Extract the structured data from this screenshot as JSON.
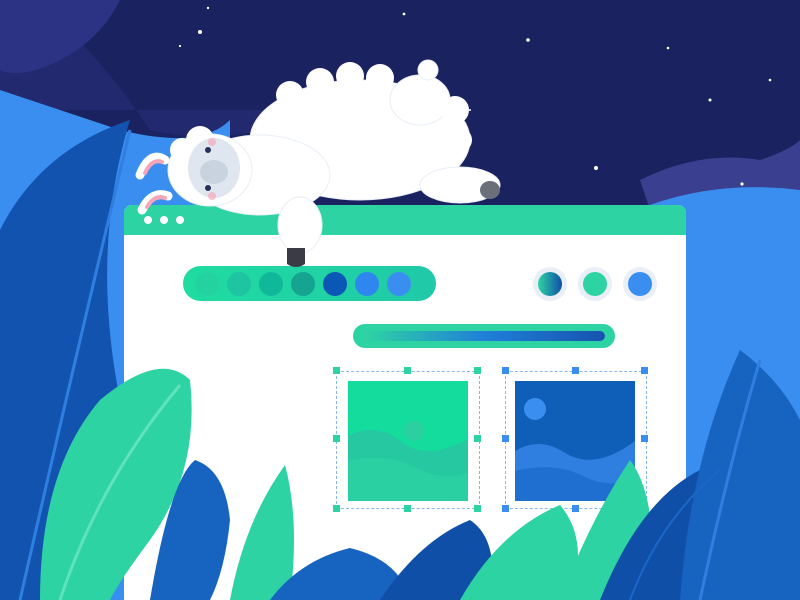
{
  "colors": {
    "sky": "#1a2260",
    "sky_band": "#3b3f8f",
    "blue_wave": "#3a8ef0",
    "window_bar": "#2ed3a3",
    "window_body": "#ffffff",
    "teal_leaf": "#2ed3a3",
    "blue_leaf": "#1763c0",
    "deep_leaf": "#0f4fa8"
  },
  "window": {
    "controls": [
      "dot",
      "dot",
      "dot"
    ]
  },
  "palette": {
    "swatches": [
      "#22d3a0",
      "#1fc4a0",
      "#10b89a",
      "#14a48f",
      "#0b57b5",
      "#2f86ef",
      "#3a8ef0"
    ],
    "pickers": [
      "#1fa7a0",
      "#2ed3a3",
      "#3a8ef0"
    ]
  },
  "slider": {
    "level": 1.0
  },
  "icons": {
    "llama": "llama-illustration",
    "image_green": "image-placeholder-icon",
    "image_blue": "image-placeholder-icon"
  }
}
